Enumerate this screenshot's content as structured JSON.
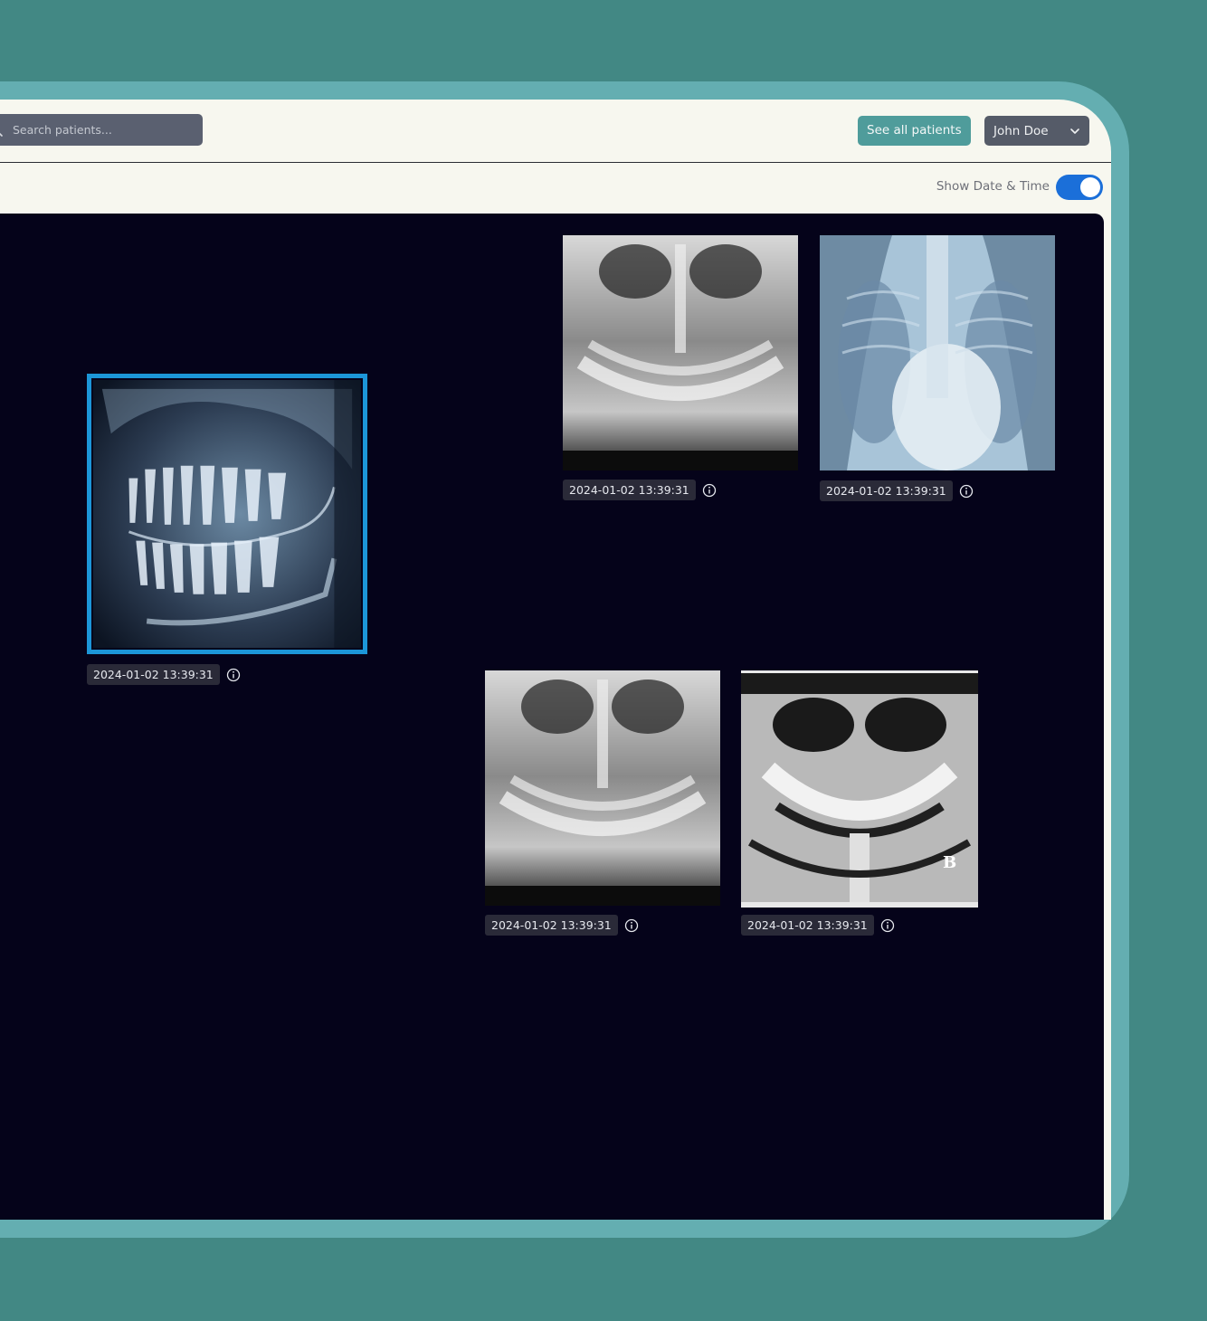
{
  "search": {
    "placeholder": "Search patients..."
  },
  "header": {
    "see_all_label": "See all patients",
    "user_name": "John Doe"
  },
  "toolbar": {
    "toggle_label": "Show Date & Time",
    "show_date_time": true
  },
  "images": [
    {
      "kind": "lateral-ceph",
      "timestamp": "2024-01-02 13:39:31",
      "selected": true
    },
    {
      "kind": "dental-panoramic",
      "timestamp": "2024-01-02 13:39:31",
      "selected": false
    },
    {
      "kind": "chest",
      "timestamp": "2024-01-02 13:39:31",
      "selected": false
    },
    {
      "kind": "dental-panoramic",
      "timestamp": "2024-01-02 13:39:31",
      "selected": false
    },
    {
      "kind": "dental-panoramic-marked",
      "marker": "B",
      "timestamp": "2024-01-02 13:39:31",
      "selected": false
    }
  ],
  "icons": {
    "search": "search-icon",
    "chevron": "chevron-down-icon",
    "info": "info-icon"
  },
  "colors": {
    "background": "#428884",
    "frame": "#64aeb1",
    "canvas": "#05031a",
    "accent": "#4f9c9b",
    "toggle": "#1b6fd9",
    "selection": "#1c96d8"
  }
}
